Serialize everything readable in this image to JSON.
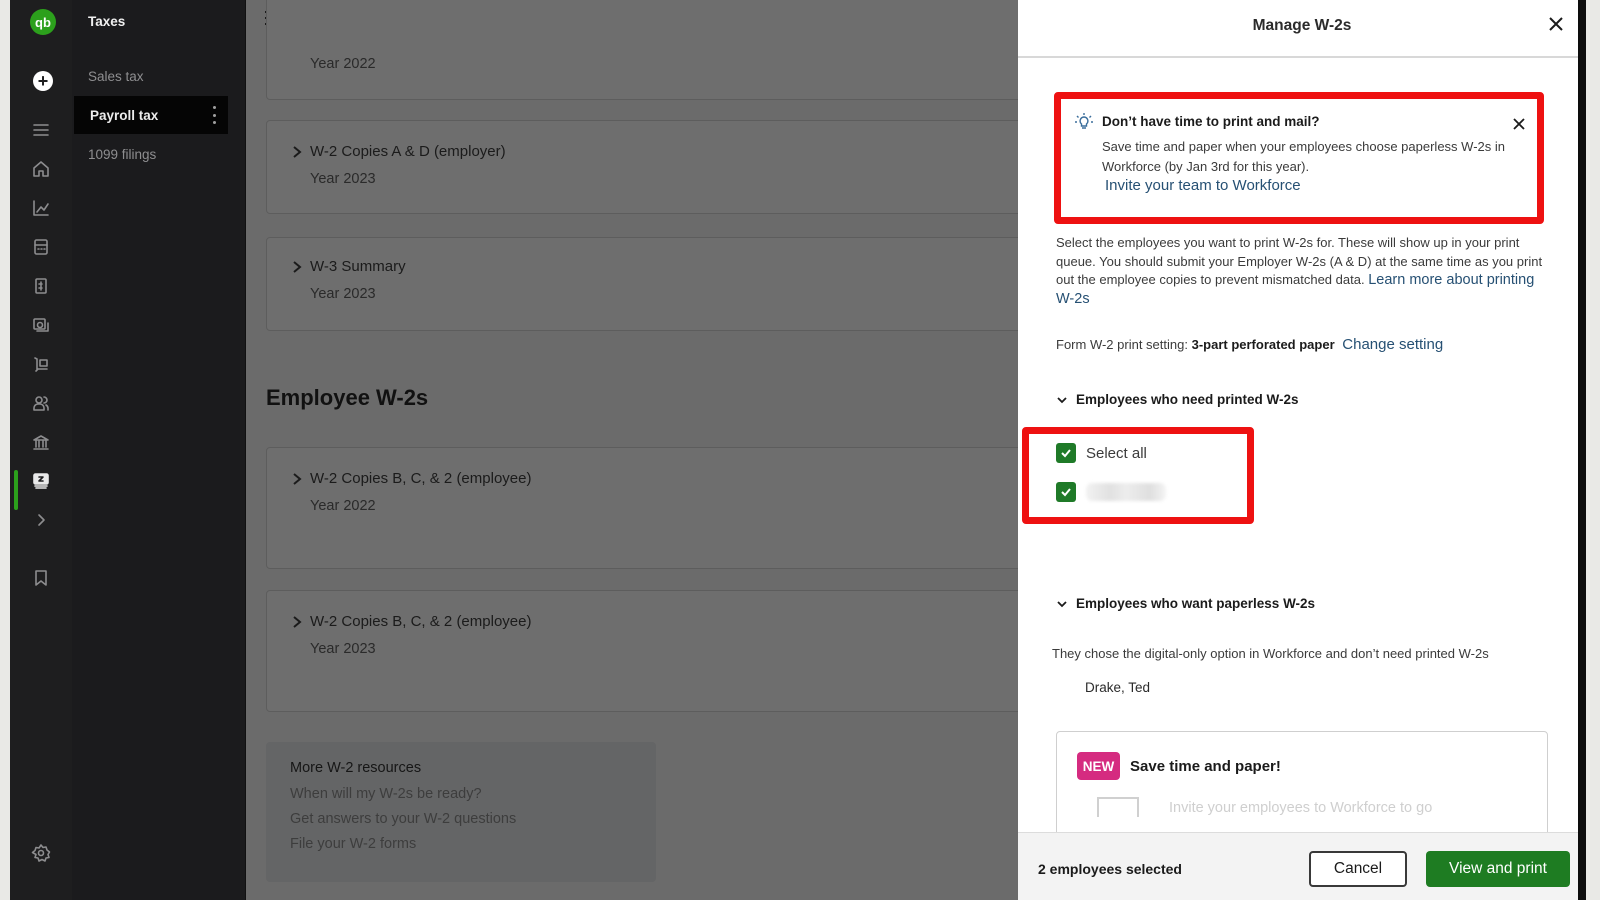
{
  "app": {
    "logo_text": "qb",
    "new_button_symbol": "+"
  },
  "rail": {
    "icons": [
      "menu-icon",
      "home-icon",
      "chart-icon",
      "calculator-icon",
      "invoice-icon",
      "expenses-icon",
      "sales-icon",
      "people-icon",
      "bank-icon",
      "taxes-icon",
      "chevron-right-icon",
      "bookmark-icon",
      "settings-icon"
    ],
    "active": "taxes-icon",
    "accent_color": "#2ca01c"
  },
  "subnav": {
    "title": "Taxes",
    "items": [
      {
        "label": "Sales tax",
        "active": false
      },
      {
        "label": "Payroll tax",
        "active": true
      },
      {
        "label": "1099 filings",
        "active": false
      }
    ]
  },
  "main": {
    "cards_top": [
      {
        "title": "",
        "year": "Year 2022"
      },
      {
        "title": "W-2 Copies A & D (employer)",
        "year": "Year 2023"
      },
      {
        "title": "W-3 Summary",
        "year": "Year 2023"
      }
    ],
    "section_heading": "Employee W-2s",
    "cards_employee": [
      {
        "title": "W-2 Copies B, C, & 2 (employee)",
        "year": "Year 2022"
      },
      {
        "title": "W-2 Copies B, C, & 2 (employee)",
        "year": "Year 2023"
      }
    ],
    "resources": {
      "title": "More W-2 resources",
      "links": [
        "When will my W-2s be ready?",
        "Get answers to your W-2 questions",
        "File your W-2 forms"
      ]
    }
  },
  "drawer": {
    "title": "Manage W-2s",
    "tip": {
      "title": "Don’t have time to print and mail?",
      "body": "Save time and paper when your employees choose paperless W-2s in Workforce (by Jan 3rd for this year).",
      "link": "Invite your team to Workforce"
    },
    "intro": {
      "text": "Select the employees you want to print W-2s for. These will show up in your print queue. You should submit your Employer W-2s (A & D) at the same time as you print out the employee copies to prevent mismatched data.",
      "link": "Learn more about printing W-2s"
    },
    "print_setting": {
      "label": "Form W-2 print setting:",
      "value": "3-part perforated paper",
      "link": "Change setting"
    },
    "need_printed": {
      "heading": "Employees who need printed W-2s",
      "select_all_label": "Select all",
      "select_all_checked": true,
      "employees": [
        {
          "name": "(redacted)",
          "checked": true
        }
      ]
    },
    "paperless": {
      "heading": "Employees who want paperless W-2s",
      "description": "They chose the digital-only option in Workforce and don’t need printed W-2s",
      "employees": [
        "Drake, Ted"
      ]
    },
    "promo": {
      "badge": "NEW",
      "title": "Save time and paper!",
      "text": "Invite your employees to Workforce to go"
    },
    "footer": {
      "selected_count": "2 employees selected",
      "cancel_label": "Cancel",
      "primary_label": "View and print"
    },
    "highlight_color": "#ee1111"
  }
}
